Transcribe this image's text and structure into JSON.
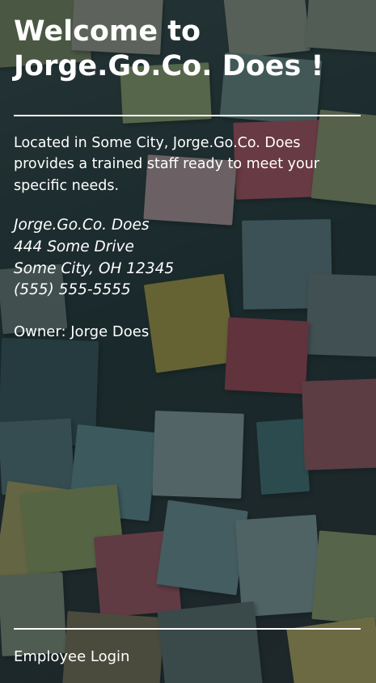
{
  "header": {
    "title_line1": "Welcome to",
    "title_line2": "Jorge.Go.Co. Does !"
  },
  "intro": {
    "text": "Located in Some City, Jorge.Go.Co. Does provides a trained staff ready to meet your specific needs."
  },
  "address": {
    "company": "Jorge.Go.Co. Does",
    "street": "444 Some Drive",
    "city_state_zip": "Some City, OH 12345",
    "phone": "(555) 555-5555"
  },
  "owner": {
    "text": "Owner: Jorge Does"
  },
  "footer": {
    "login_label": "Employee Login"
  },
  "colors": {
    "text": "#ffffff",
    "overlay": "#122022"
  }
}
